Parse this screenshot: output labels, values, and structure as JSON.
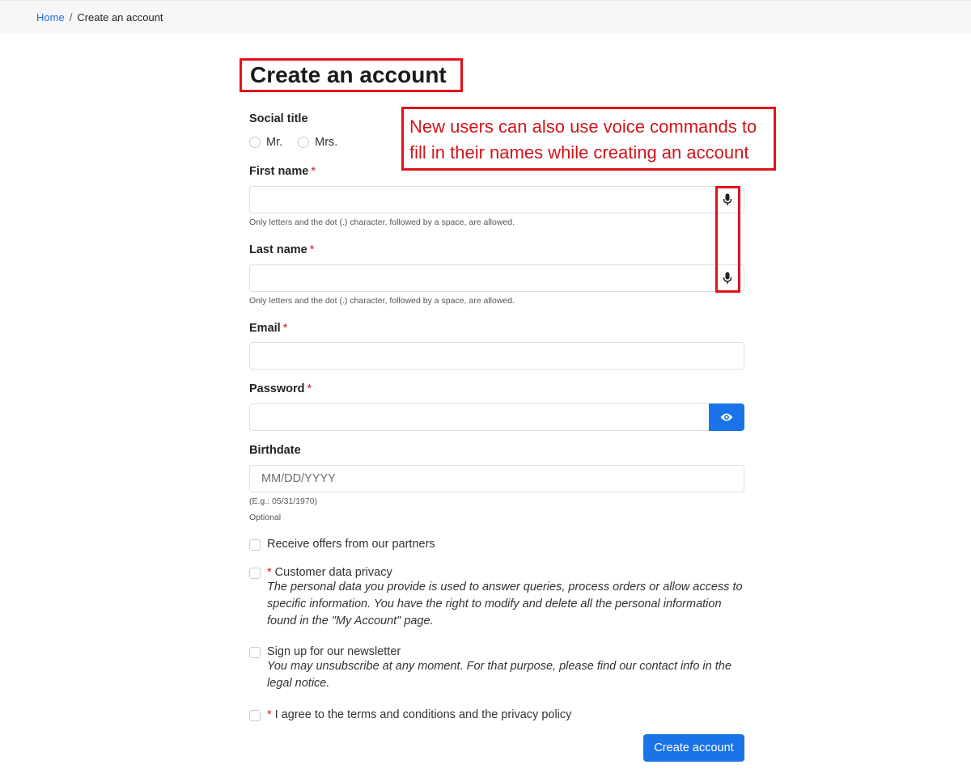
{
  "breadcrumb": {
    "home": "Home",
    "separator": "/",
    "current": "Create an account"
  },
  "page_title": "Create an account",
  "annotation": {
    "line1": "New users can also use voice commands to",
    "line2": "fill in their names while creating an account"
  },
  "form": {
    "social_title": {
      "label": "Social title",
      "options": [
        "Mr.",
        "Mrs."
      ]
    },
    "first_name": {
      "label": "First name",
      "required_mark": "*",
      "value": "",
      "help": "Only letters and the dot (.) character, followed by a space, are allowed."
    },
    "last_name": {
      "label": "Last name",
      "required_mark": "*",
      "value": "",
      "help": "Only letters and the dot (.) character, followed by a space, are allowed."
    },
    "email": {
      "label": "Email",
      "required_mark": "*",
      "value": ""
    },
    "password": {
      "label": "Password",
      "required_mark": "*",
      "value": ""
    },
    "birthdate": {
      "label": "Birthdate",
      "placeholder": "MM/DD/YYYY",
      "help": "(E.g.: 05/31/1970)",
      "optional": "Optional"
    },
    "checkboxes": {
      "partners": {
        "label": "Receive offers from our partners"
      },
      "privacy": {
        "required_mark": "*",
        "label": "Customer data privacy",
        "description": "The personal data you provide is used to answer queries, process orders or allow access to specific information. You have the right to modify and delete all the personal information found in the \"My Account\" page."
      },
      "newsletter": {
        "label": "Sign up for our newsletter",
        "description": "You may unsubscribe at any moment. For that purpose, please find our contact info in the legal notice."
      },
      "terms": {
        "required_mark": "*",
        "label": "I agree to the terms and conditions and the privacy policy"
      }
    },
    "submit_label": "Create account"
  },
  "colors": {
    "accent": "#1a73e8",
    "highlight": "#e2121b",
    "link": "#1f6fd6"
  },
  "icons": {
    "mic": "microphone-icon",
    "eye": "eye-icon"
  }
}
